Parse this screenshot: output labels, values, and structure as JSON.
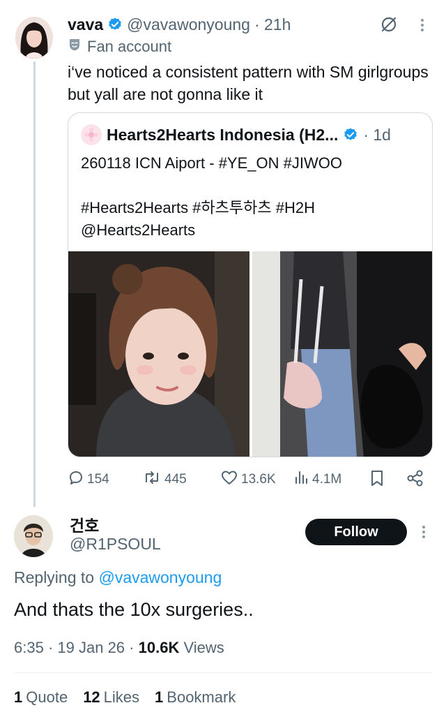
{
  "tweet": {
    "author_name": "vava",
    "handle": "@vavawonyoung",
    "time": "· 21h",
    "label": "Fan account",
    "text": "i‘ve noticed a consistent pattern with SM girlgroups but yall are not gonna like it",
    "quote": {
      "author_name": "Hearts2Hearts Indonesia (H2...",
      "time": "· 1d",
      "line1": "260118 ICN Aiport - #YE_ON #JIWOO",
      "line2": "#Hearts2Hearts #하츠투하츠 #H2H",
      "line3": "@Hearts2Hearts"
    },
    "stats": {
      "replies": "154",
      "reposts": "445",
      "likes": "13.6K",
      "views": "4.1M"
    }
  },
  "reply": {
    "author_name": "건호",
    "handle": "@R1PSOUL",
    "follow_label": "Follow",
    "replying_prefix": "Replying to",
    "replying_to": "@vavawonyoung",
    "text": "And thats the 10x surgeries..",
    "time": "6:35",
    "date": "19 Jan 26",
    "views_count": "10.6K",
    "views_label": "Views",
    "quotes_count": "1",
    "quotes_label": "Quote",
    "likes_count": "12",
    "likes_label": "Likes",
    "bookmarks_count": "1",
    "bookmarks_label": "Bookmark"
  },
  "colors": {
    "accent": "#1d9bf0",
    "text": "#0f1419",
    "muted": "#536471",
    "border": "#cfd9de"
  },
  "icons": [
    "verified-badge-icon",
    "mute-icon",
    "more-icon",
    "fan-account-icon",
    "reply-icon",
    "repost-icon",
    "like-icon",
    "views-icon",
    "bookmark-icon",
    "share-icon"
  ]
}
